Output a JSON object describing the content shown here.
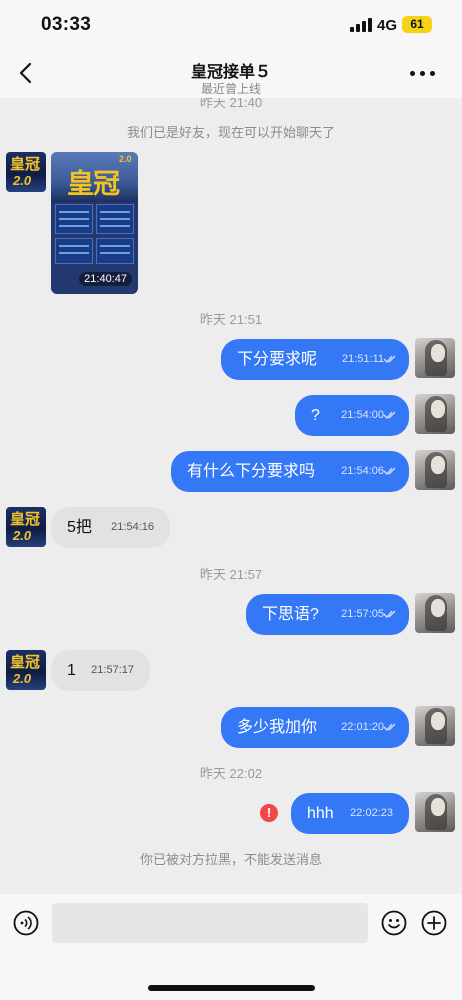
{
  "status_bar": {
    "time": "03:33",
    "network": "4G",
    "battery": "61"
  },
  "header": {
    "title": "皇冠接单５",
    "subtitle": "最近曾上线"
  },
  "chat": {
    "clipped_time": "昨天 21:40",
    "friend_notice": "我们已是好友，现在可以开始聊天了",
    "image_message": {
      "title": "皇冠",
      "version": "2.0",
      "time": "21:40:47"
    },
    "timestamps": [
      "昨天 21:51",
      "昨天 21:57",
      "昨天 22:02"
    ],
    "messages": [
      {
        "side": "out",
        "text": "下分要求呢",
        "time": "21:51:11"
      },
      {
        "side": "out",
        "text": "?",
        "time": "21:54:00"
      },
      {
        "side": "out",
        "text": "有什么下分要求吗",
        "time": "21:54:06"
      },
      {
        "side": "in",
        "text": "5把",
        "time": "21:54:16"
      },
      {
        "side": "out",
        "text": "下思语?",
        "time": "21:57:05"
      },
      {
        "side": "in",
        "text": "1",
        "time": "21:57:17"
      },
      {
        "side": "out",
        "text": "多少我加你",
        "time": "22:01:20"
      },
      {
        "side": "out",
        "text": "hhh",
        "time": "22:02:23",
        "failed": true
      }
    ],
    "blocked_notice": "你已被对方拉黑，不能发送消息",
    "avatar_logo": {
      "line1": "皇冠",
      "line2": "2.0"
    },
    "error_symbol": "!"
  },
  "input_bar": {
    "value": "",
    "placeholder": ""
  },
  "icons": {
    "back": "chevron-left-icon",
    "more": "more-dots-icon",
    "voice": "voice-icon",
    "emoji": "emoji-icon",
    "add": "plus-circle-icon"
  },
  "colors": {
    "outgoing_bubble": "#3478f6",
    "incoming_bubble": "#e2e2e2",
    "background": "#ededed",
    "error": "#f04848",
    "battery": "#f5d218"
  }
}
